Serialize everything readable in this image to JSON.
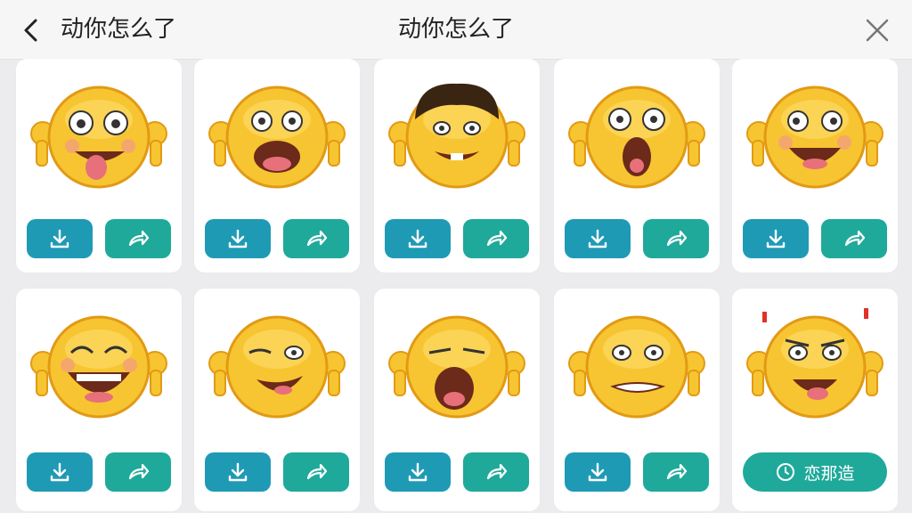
{
  "header": {
    "left_title": "动你怎么了",
    "center_title": "动你怎么了",
    "back_icon": "chevron-left-icon",
    "close_icon": "close-icon"
  },
  "cards": [
    {
      "emoji": "tongue-out-emoji",
      "actions": [
        "download",
        "share"
      ]
    },
    {
      "emoji": "shouting-emoji",
      "actions": [
        "download",
        "share"
      ]
    },
    {
      "emoji": "hair-grin-emoji",
      "actions": [
        "download",
        "share"
      ]
    },
    {
      "emoji": "shocked-emoji",
      "actions": [
        "download",
        "share"
      ]
    },
    {
      "emoji": "crazy-laugh-emoji",
      "actions": [
        "download",
        "share"
      ]
    },
    {
      "emoji": "laughing-tears-emoji",
      "actions": [
        "download",
        "share"
      ]
    },
    {
      "emoji": "wink-smirk-emoji",
      "actions": [
        "download",
        "share"
      ]
    },
    {
      "emoji": "yawning-emoji",
      "actions": [
        "download",
        "share"
      ]
    },
    {
      "emoji": "grimace-emoji",
      "actions": [
        "download",
        "share"
      ]
    },
    {
      "emoji": "angry-shout-emoji",
      "actions": [
        "make"
      ]
    }
  ],
  "make_button_label": "恋那造",
  "colors": {
    "download": "#1f9ab5",
    "share": "#1fa99a",
    "emoji_face": "#f7c531",
    "emoji_shadow": "#e29a15"
  }
}
